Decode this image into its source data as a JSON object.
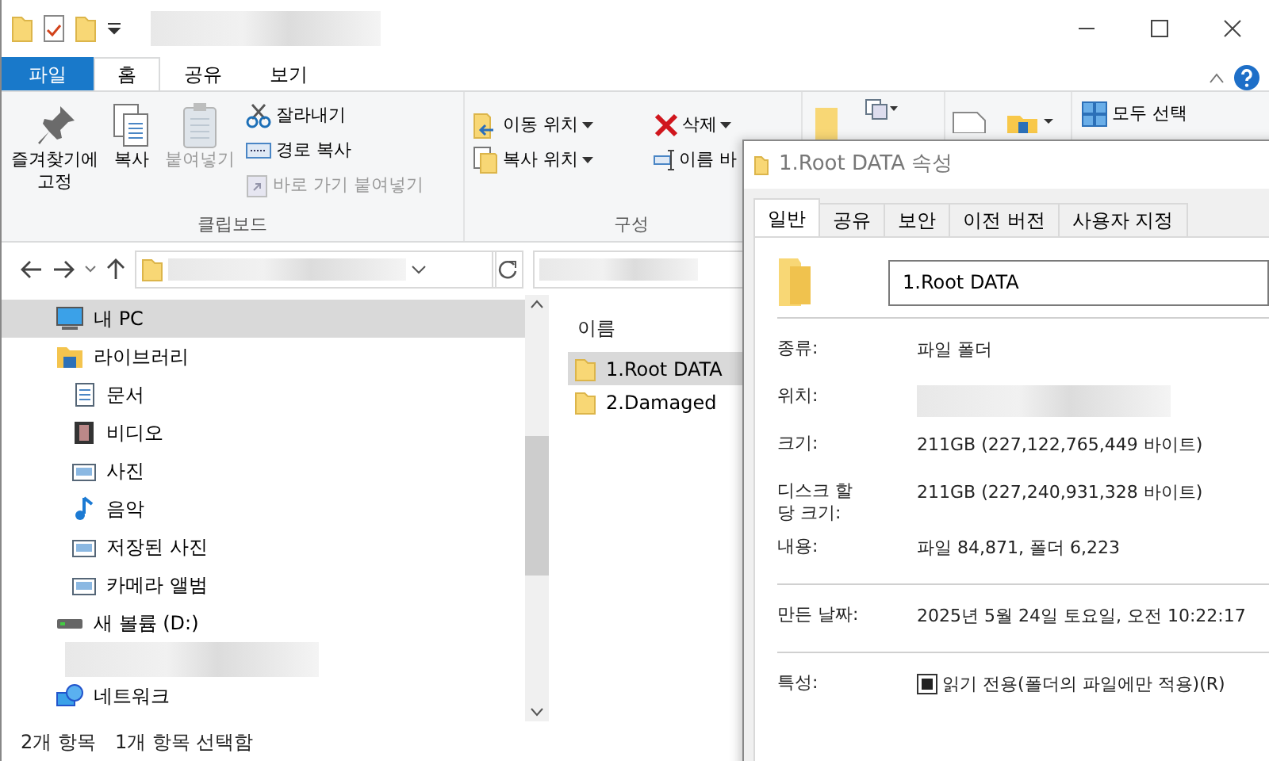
{
  "ribbon": {
    "tabs": [
      {
        "label": "파일",
        "kind": "file",
        "selected": false
      },
      {
        "label": "홈",
        "kind": "tab",
        "selected": true
      },
      {
        "label": "공유",
        "kind": "tab",
        "selected": false
      },
      {
        "label": "보기",
        "kind": "tab",
        "selected": false
      }
    ],
    "clipboard": {
      "label": "클립보드",
      "large_buttons": [
        {
          "label": "즐겨찾기에\n고정",
          "kind": "pin",
          "disabled": false
        },
        {
          "label": "복사",
          "kind": "copy",
          "disabled": false
        },
        {
          "label": "붙여넣기",
          "kind": "paste",
          "disabled": true
        }
      ],
      "small_buttons": [
        {
          "label": "잘라내기",
          "kind": "cut",
          "disabled": false
        },
        {
          "label": "경로 복사",
          "kind": "path",
          "disabled": false
        },
        {
          "label": "바로 가기 붙여넣기",
          "kind": "shortcut",
          "disabled": true
        }
      ]
    },
    "organize": {
      "label": "구성",
      "buttons": [
        {
          "label": "이동 위치",
          "kind": "move",
          "dropdown": true
        },
        {
          "label": "복사 위치",
          "kind": "copyto",
          "dropdown": true
        },
        {
          "label": "삭제",
          "kind": "delete",
          "dropdown": true
        },
        {
          "label": "이름 바",
          "kind": "rename",
          "dropdown": false
        }
      ]
    },
    "select_all": "모두 선택"
  },
  "sidebar": {
    "items": [
      {
        "label": "내 PC",
        "kind": "pc",
        "selected": true
      },
      {
        "label": "라이브러리",
        "kind": "library",
        "selected": false,
        "children": [
          {
            "label": "문서",
            "kind": "doc",
            "selected": false
          },
          {
            "label": "비디오",
            "kind": "video",
            "selected": false
          },
          {
            "label": "사진",
            "kind": "image",
            "selected": false
          },
          {
            "label": "음악",
            "kind": "music",
            "selected": false
          },
          {
            "label": "저장된 사진",
            "kind": "image",
            "selected": false
          },
          {
            "label": "카메라 앨범",
            "kind": "image",
            "selected": false
          }
        ]
      },
      {
        "label": "새 볼륨 (D:)",
        "kind": "drive",
        "selected": false
      },
      {
        "label": "네트워크",
        "kind": "network",
        "selected": false
      }
    ]
  },
  "files": {
    "column": "이름",
    "items": [
      {
        "name": "1.Root DATA",
        "selected": true
      },
      {
        "name": "2.Damaged",
        "selected": false
      }
    ]
  },
  "status_bar": [
    "2개 항목",
    "1개 항목 선택함"
  ],
  "dialog": {
    "title": "1.Root DATA 속성",
    "tabs": [
      {
        "label": "일반",
        "selected": true
      },
      {
        "label": "공유",
        "selected": false
      },
      {
        "label": "보안",
        "selected": false
      },
      {
        "label": "이전 버전",
        "selected": false
      },
      {
        "label": "사용자 지정",
        "selected": false
      }
    ],
    "name_value": "1.Root DATA",
    "sections": [
      [
        {
          "label": "종류:",
          "value": "파일 폴더"
        },
        {
          "label": "위치:",
          "redacted": true
        },
        {
          "label": "크기:",
          "value": "211GB (227,122,765,449 바이트)"
        },
        {
          "label": "디스크 할\n당 크기:",
          "value": "211GB (227,240,931,328 바이트)"
        },
        {
          "label": "내용:",
          "value": "파일 84,871, 폴더 6,223"
        }
      ],
      [
        {
          "label": "만든 날짜:",
          "value": "2025년 5월 24일 토요일, 오전 10:22:17"
        }
      ]
    ],
    "attributes": {
      "label": "특성:",
      "options": [
        {
          "label": "읽기 전용(폴더의 파일에만 적용)(R)",
          "indeterminate": true
        }
      ]
    }
  }
}
